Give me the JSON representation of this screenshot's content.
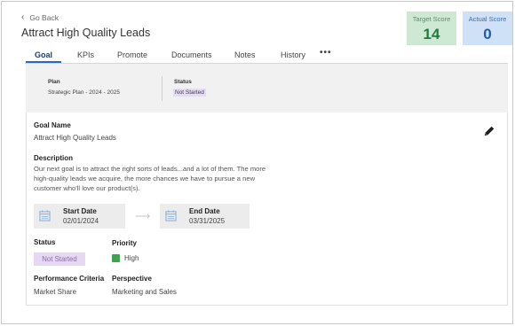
{
  "header": {
    "go_back": "Go Back",
    "title": "Attract High Quality Leads"
  },
  "scores": {
    "target_label": "Target Score",
    "target_value": "14",
    "actual_label": "Actual Score",
    "actual_value": "0"
  },
  "tabs": [
    "Goal",
    "KPIs",
    "Promote",
    "Documents",
    "Notes",
    "History"
  ],
  "more_menu": "•••",
  "plan_bar": {
    "plan_label": "Plan",
    "plan_value": "Strategic Plan - 2024 - 2025",
    "status_label": "Status",
    "status_value": "Not Started"
  },
  "goal": {
    "name_label": "Goal Name",
    "name_value": "Attract High Quality Leads",
    "description_label": "Description",
    "description_lines": [
      "Our next goal is to attract the right sorts of leads...and a lot of them. The more",
      "high-quality leads we acquire, the more chances we have to pursue a new",
      "customer who'll love our product(s)."
    ],
    "start_label": "Start Date",
    "start_value": "02/01/2024",
    "end_label": "End Date",
    "end_value": "03/31/2025",
    "status_label": "Status",
    "status_value": "Not Started",
    "priority_label": "Priority",
    "priority_value": "High",
    "criteria_label": "Performance Criteria",
    "criteria_value": "Market Share",
    "perspective_label": "Perspective",
    "perspective_value": "Marketing and Sales"
  },
  "colors": {
    "accent": "#2a67c4",
    "target_bg": "#cde9d4",
    "actual_bg": "#cfe1f7",
    "status_badge_bg": "#e6d8f2",
    "priority_high": "#3fa24e"
  },
  "icons": [
    "chevron-left-icon",
    "pencil-icon",
    "calendar-icon",
    "arrow-right-icon",
    "priority-high-icon",
    "more-icon"
  ]
}
